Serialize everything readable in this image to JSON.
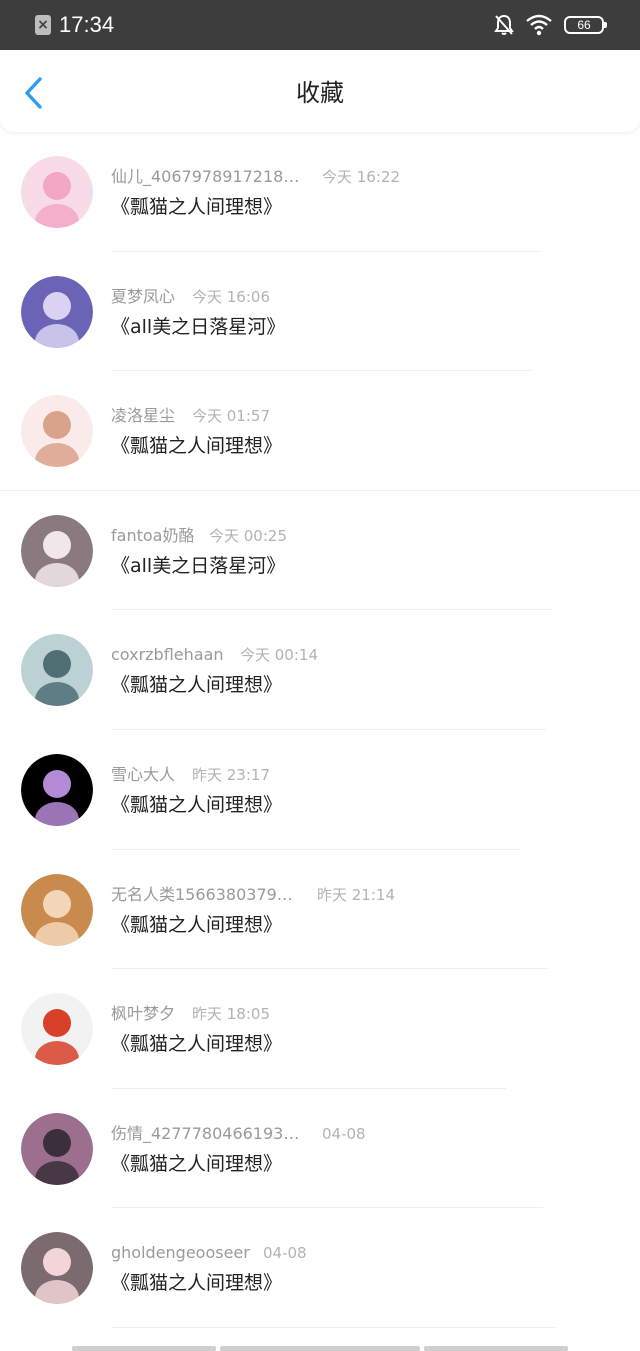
{
  "status_bar": {
    "time": "17:34",
    "battery": "66",
    "icons": [
      "app-notification-icon",
      "mute-bell-icon",
      "wifi-icon",
      "battery-icon"
    ]
  },
  "header": {
    "title": "收藏",
    "back_icon": "chevron-left-icon",
    "accent_color": "#2e9cf0"
  },
  "favorites": [
    {
      "user": "仙儿_4067978917218…",
      "time": "今天 16:22",
      "title": "《瓢猫之人间理想》",
      "avatar_bg": "#f8dbe6",
      "avatar_fg": "#f3a7c4"
    },
    {
      "user": "夏梦凤心",
      "time": "今天 16:06",
      "title": "《all美之日落星河》",
      "avatar_bg": "#6b63b5",
      "avatar_fg": "#d9d2f2"
    },
    {
      "user": "凌洛星尘",
      "time": "今天 01:57",
      "title": "《瓢猫之人间理想》",
      "avatar_bg": "#fbeaea",
      "avatar_fg": "#d9a28b"
    },
    {
      "user": "fantoa奶酪",
      "time": "今天 00:25",
      "title": "《all美之日落星河》",
      "avatar_bg": "#8a7a80",
      "avatar_fg": "#f1e7ea"
    },
    {
      "user": "coxrzbflehaan",
      "time": "今天 00:14",
      "title": "《瓢猫之人间理想》",
      "avatar_bg": "#bcd1d4",
      "avatar_fg": "#4f6f75"
    },
    {
      "user": "雪心大人",
      "time": "昨天 23:17",
      "title": "《瓢猫之人间理想》",
      "avatar_bg": "#000000",
      "avatar_fg": "#b48ad6"
    },
    {
      "user": "无名人类1566380379…",
      "time": "昨天 21:14",
      "title": "《瓢猫之人间理想》",
      "avatar_bg": "#c98a4d",
      "avatar_fg": "#f3d6b8"
    },
    {
      "user": "枫叶梦夕",
      "time": "昨天 18:05",
      "title": "《瓢猫之人间理想》",
      "avatar_bg": "#f2f2f2",
      "avatar_fg": "#d8402a"
    },
    {
      "user": "伤情_4277780466193…",
      "time": "04-08",
      "title": "《瓢猫之人间理想》",
      "avatar_bg": "#9c6f8e",
      "avatar_fg": "#3a2f3a"
    },
    {
      "user": "gholdengeooseer",
      "time": "04-08",
      "title": "《瓢猫之人间理想》",
      "avatar_bg": "#7b6a6e",
      "avatar_fg": "#f3d4d8"
    }
  ],
  "colors": {
    "status_bar_bg": "#3d3d3d",
    "meta_text": "#9a9a9a",
    "title_text": "#222222"
  }
}
